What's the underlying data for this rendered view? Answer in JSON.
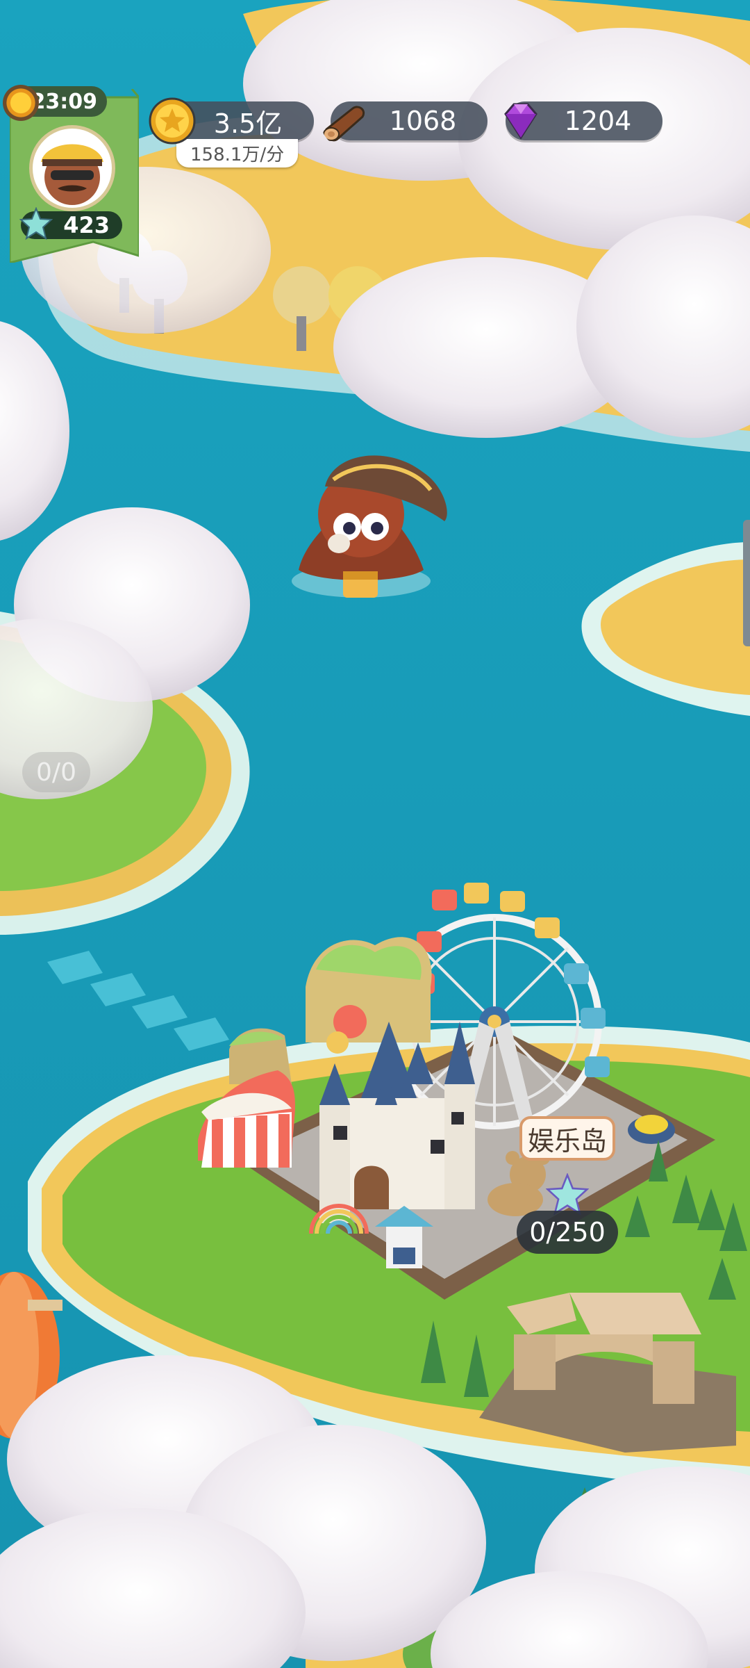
{
  "hud": {
    "clock": "23:09",
    "player_level": "423",
    "coins": "3.5亿",
    "coin_rate": "158.1万/分",
    "wood": "1068",
    "gems": "1204"
  },
  "map": {
    "locked_island_progress": "0/0",
    "island_name": "娱乐岛",
    "island_progress": "0/250"
  },
  "colors": {
    "sea": "#169bb7",
    "sand": "#f2c75a",
    "grass": "#7cc242",
    "cloud": "#f2eff3",
    "hud_pill": "#464e5c"
  },
  "icons": [
    "sun-icon",
    "star-icon",
    "coin-icon",
    "wood-log-icon",
    "gem-icon"
  ]
}
